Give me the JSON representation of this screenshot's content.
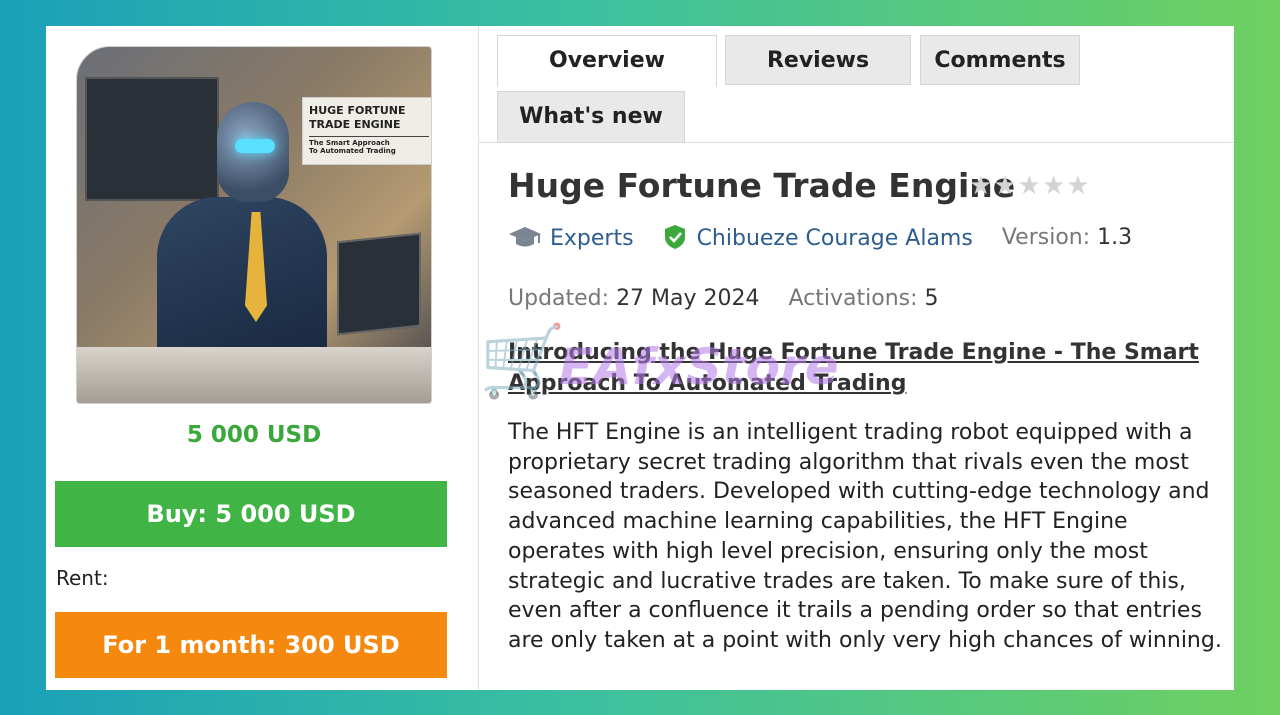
{
  "product": {
    "image_text": {
      "title_line1": "HUGE FORTUNE",
      "title_line2": "TRADE ENGINE",
      "subtitle_line1": "The Smart Approach",
      "subtitle_line2": "To Automated Trading"
    },
    "price": "5 000 USD",
    "buy_button": "Buy: 5 000 USD",
    "rent_label": "Rent:",
    "rent_button": "For 1 month: 300 USD"
  },
  "tabs": [
    {
      "label": "Overview",
      "active": true
    },
    {
      "label": "Reviews",
      "active": false
    },
    {
      "label": "Comments",
      "active": false
    },
    {
      "label": "What's new",
      "active": false
    }
  ],
  "details": {
    "title": "Huge Fortune Trade Engine",
    "rating": {
      "stars_filled": 0,
      "stars_total": 5
    },
    "category": "Experts",
    "author": "Chibueze Courage Alams",
    "version_label": "Version:",
    "version_value": "1.3",
    "updated_label": "Updated:",
    "updated_value": "27 May 2024",
    "activations_label": "Activations:",
    "activations_value": "5",
    "headline": "Introducing the Huge Fortune Trade Engine - The Smart Approach To Automated Trading",
    "description": "The HFT Engine is an intelligent trading robot equipped with a proprietary secret trading algorithm that rivals even the most seasoned traders. Developed with cutting-edge technology and advanced machine learning capabilities, the HFT Engine operates with high level precision, ensuring only the most strategic and lucrative trades are taken. To make sure of this, even after a confluence it trails a pending order so that entries are only taken at a point with only very high chances of winning."
  },
  "watermark": "EAfxStore",
  "colors": {
    "buy_green": "#40b444",
    "rent_orange": "#f5880e",
    "price_green": "#3aa83a",
    "link_blue": "#2d5d8f"
  }
}
